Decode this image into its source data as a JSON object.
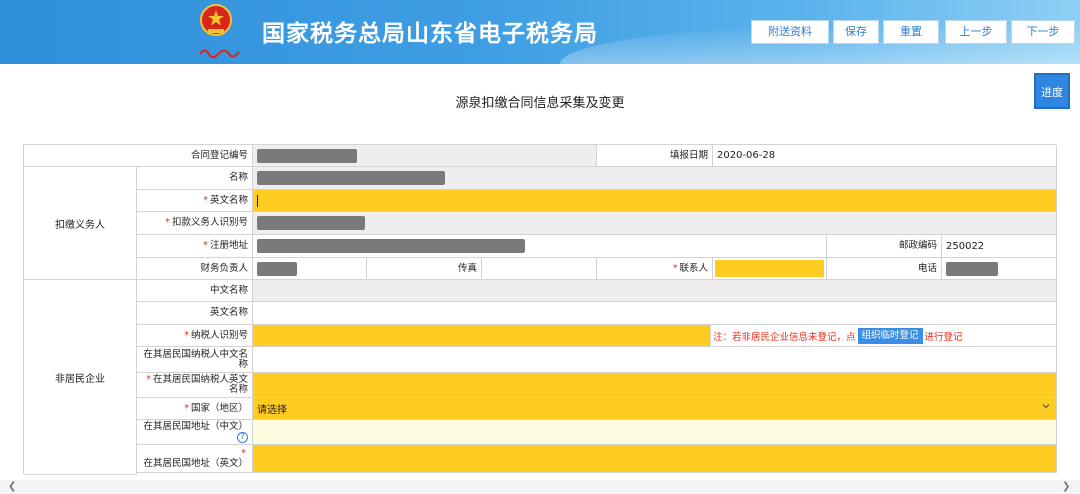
{
  "header": {
    "title": "国家税务总局山东省电子税务局",
    "logo_caption": "中国税务",
    "buttons": {
      "attach": "附送资料",
      "save": "保存",
      "reset": "重置",
      "prev": "上一步",
      "next": "下一步"
    }
  },
  "page": {
    "title": "源泉扣缴合同信息采集及变更",
    "progress_label": "进度"
  },
  "form": {
    "contract_no_label": "合同登记编号",
    "fill_date_label": "填报日期",
    "fill_date_value": "2020-06-28",
    "withholding_group": "扣缴义务人",
    "name_label": "名称",
    "en_name_label": "英文名称",
    "withholder_id_label": "扣款义务人识别号",
    "reg_address_label": "注册地址",
    "postal_label": "邮政编码",
    "postal_value": "250022",
    "finance_label": "财务负责人",
    "fax_label": "传真",
    "contact_label": "联系人",
    "phone_label": "电话",
    "nonresident_group": "非居民企业",
    "cn_name_label": "中文名称",
    "en_name2_label": "英文名称",
    "taxpayer_id_label": "纳税人识别号",
    "note_prefix": "注：若非居民企业信息未登记，点",
    "note_button": "组织临时登记",
    "note_suffix": "进行登记",
    "res_cn_name_label": "在其居民国纳税人中文名称",
    "res_en_name_label": "在其居民国纳税人英文名称",
    "country_label": "国家（地区）",
    "country_value": "请选择",
    "res_cn_addr_label": "在其居民国地址（中文）",
    "res_en_addr_label": "在其居民国地址（英文）",
    "required_mark": "*"
  },
  "colors": {
    "header_blue": "#2f8fd9",
    "required_yellow": "#ffcc22",
    "readonly_gray": "#efeded",
    "note_red": "#e0301e",
    "button_blue": "#3a8ee6"
  }
}
